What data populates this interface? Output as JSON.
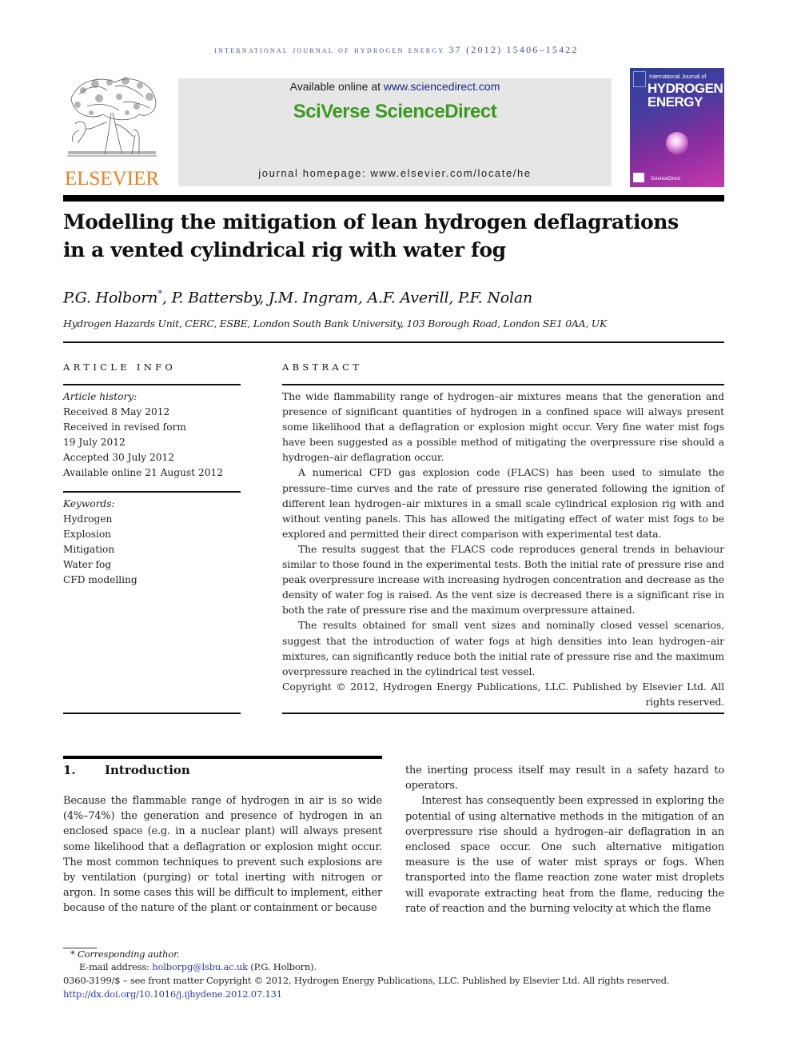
{
  "running_head": "INTERNATIONAL JOURNAL OF HYDROGEN ENERGY 37 (2012) 15406–15422",
  "publisher": {
    "logo_text": "ELSEVIER"
  },
  "sciencedirect": {
    "available_prefix": "Available online at ",
    "available_link": "www.sciencedirect.com",
    "brand": "SciVerse ScienceDirect",
    "homepage": "journal homepage: www.elsevier.com/locate/he"
  },
  "cover": {
    "line1": "International Journal of",
    "line2": "HYDROGEN",
    "line3": "ENERGY",
    "footer": "ScienceDirect"
  },
  "article": {
    "title_line1": "Modelling the mitigation of lean hydrogen deflagrations",
    "title_line2": "in a vented cylindrical rig with water fog",
    "authors_first": "P.G. Holborn",
    "author_marker": "*",
    "authors_rest": ", P. Battersby, J.M. Ingram, A.F. Averill, P.F. Nolan",
    "affiliation": "Hydrogen Hazards Unit, CERC, ESBE, London South Bank University, 103 Borough Road, London SE1 0AA, UK"
  },
  "article_info": {
    "heading": "ARTICLE INFO",
    "history_label": "Article history:",
    "history": [
      "Received 8 May 2012",
      "Received in revised form",
      "19 July 2012",
      "Accepted 30 July 2012",
      "Available online 21 August 2012"
    ],
    "keywords_label": "Keywords:",
    "keywords": [
      "Hydrogen",
      "Explosion",
      "Mitigation",
      "Water fog",
      "CFD modelling"
    ]
  },
  "abstract": {
    "heading": "ABSTRACT",
    "paragraphs": [
      "The wide flammability range of hydrogen–air mixtures means that the generation and presence of significant quantities of hydrogen in a confined space will always present some likelihood that a deflagration or explosion might occur. Very fine water mist fogs have been suggested as a possible method of mitigating the overpressure rise should a hydrogen–air deflagration occur.",
      "A numerical CFD gas explosion code (FLACS) has been used to simulate the pressure–time curves and the rate of pressure rise generated following the ignition of different lean hydrogen–air mixtures in a small scale cylindrical explosion rig with and without venting panels. This has allowed the mitigating effect of water mist fogs to be explored and permitted their direct comparison with experimental test data.",
      "The results suggest that the FLACS code reproduces general trends in behaviour similar to those found in the experimental tests. Both the initial rate of pressure rise and peak overpressure increase with increasing hydrogen concentration and decrease as the density of water fog is raised. As the vent size is decreased there is a significant rise in both the rate of pressure rise and the maximum overpressure attained.",
      "The results obtained for small vent sizes and nominally closed vessel scenarios, suggest that the introduction of water fogs at high densities into lean hydrogen–air mixtures, can significantly reduce both the initial rate of pressure rise and the maximum overpressure reached in the cylindrical test vessel."
    ],
    "copyright": "Copyright © 2012, Hydrogen Energy Publications, LLC. Published by Elsevier Ltd. All rights reserved."
  },
  "introduction": {
    "number": "1.",
    "title": "Introduction",
    "left_paragraph": "Because the flammable range of hydrogen in air is so wide (4%–74%) the generation and presence of hydrogen in an enclosed space (e.g. in a nuclear plant) will always present some likelihood that a deflagration or explosion might occur. The most common techniques to prevent such explosions are by ventilation (purging) or total inerting with nitrogen or argon. In some cases this will be difficult to implement, either because of the nature of the plant or containment or because",
    "right_paragraph_cont": "the inerting process itself may result in a safety hazard to operators.",
    "right_paragraph_2": "Interest has consequently been expressed in exploring the potential of using alternative methods in the mitigation of an overpressure rise should a hydrogen–air deflagration in an enclosed space occur. One such alternative mitigation measure is the use of water mist sprays or fogs. When transported into the flame reaction zone water mist droplets will evaporate extracting heat from the flame, reducing the rate of reaction and the burning velocity at which the flame"
  },
  "footnotes": {
    "corresponding_marker": "*",
    "corresponding_label": " Corresponding author.",
    "email_label": "E-mail address: ",
    "email": "holborpg@lsbu.ac.uk",
    "email_suffix": " (P.G. Holborn).",
    "front_matter": "0360-3199/$ – see front matter Copyright © 2012, Hydrogen Energy Publications, LLC. Published by Elsevier Ltd. All rights reserved.",
    "doi": "http://dx.doi.org/10.1016/j.ijhydene.2012.07.131"
  },
  "colors": {
    "elsevier_orange": "#f07d1a",
    "sciencedirect_green": "#3a9a1f",
    "link_blue": "#2a3aa0",
    "running_head": "#4a4f8a"
  }
}
